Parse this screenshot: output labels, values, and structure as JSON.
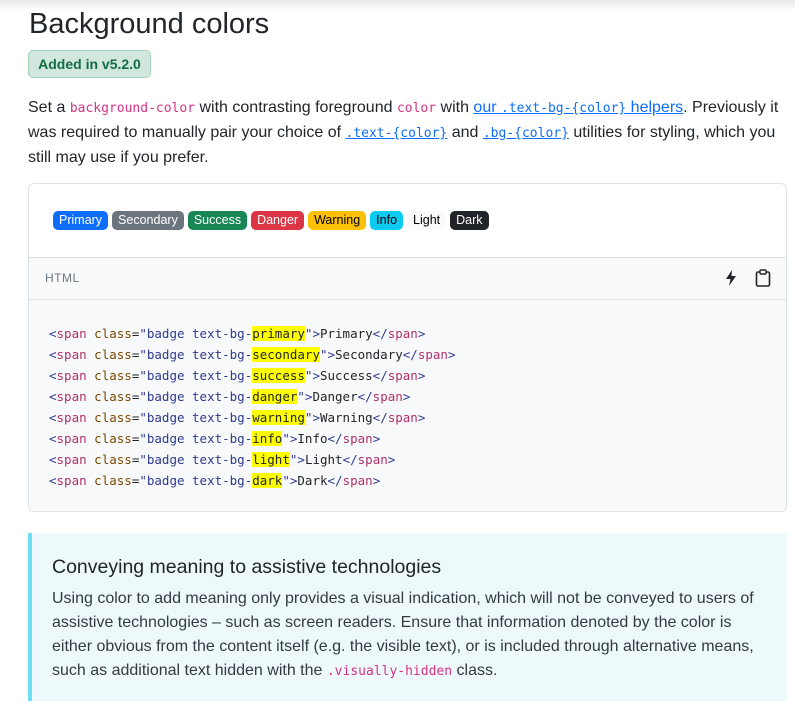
{
  "heading": "Background colors",
  "added_badge": "Added in v5.2.0",
  "intro": {
    "t1": "Set a ",
    "c1": "background-color",
    "t2": " with contrasting foreground ",
    "c2": "color",
    "t3": " with ",
    "link1_text": "our ",
    "link1_code": ".text-bg-{color}",
    "link1_tail": " helpers",
    "t4": ". Previously it was required to manually pair your choice of ",
    "link2_code": ".text-{color}",
    "t5": " and ",
    "link3_code": ".bg-{color}",
    "t6": " utilities for styling, which you still may use if you prefer."
  },
  "badges": [
    {
      "label": "Primary",
      "bg": "#0d6efd",
      "fg": "#ffffff"
    },
    {
      "label": "Secondary",
      "bg": "#6c757d",
      "fg": "#ffffff"
    },
    {
      "label": "Success",
      "bg": "#198754",
      "fg": "#ffffff"
    },
    {
      "label": "Danger",
      "bg": "#dc3545",
      "fg": "#ffffff"
    },
    {
      "label": "Warning",
      "bg": "#ffc107",
      "fg": "#000000"
    },
    {
      "label": "Info",
      "bg": "#0dcaf0",
      "fg": "#000000"
    },
    {
      "label": "Light",
      "bg": "#f8f9fa",
      "fg": "#000000"
    },
    {
      "label": "Dark",
      "bg": "#212529",
      "fg": "#ffffff"
    }
  ],
  "code_bar": {
    "language": "HTML",
    "icons": [
      "lightning-icon",
      "clipboard-icon"
    ]
  },
  "code_lines": [
    {
      "variant": "primary",
      "text": "Primary"
    },
    {
      "variant": "secondary",
      "text": "Secondary"
    },
    {
      "variant": "success",
      "text": "Success"
    },
    {
      "variant": "danger",
      "text": "Danger"
    },
    {
      "variant": "warning",
      "text": "Warning"
    },
    {
      "variant": "info",
      "text": "Info"
    },
    {
      "variant": "light",
      "text": "Light"
    },
    {
      "variant": "dark",
      "text": "Dark"
    }
  ],
  "callout": {
    "title": "Conveying meaning to assistive technologies",
    "body_pre": "Using color to add meaning only provides a visual indication, which will not be conveyed to users of assistive technologies – such as screen readers. Ensure that information denoted by the color is either obvious from the content itself (e.g. the visible text), or is included through alternative means, such as additional text hidden with the ",
    "body_code": ".visually-hidden",
    "body_post": " class."
  }
}
